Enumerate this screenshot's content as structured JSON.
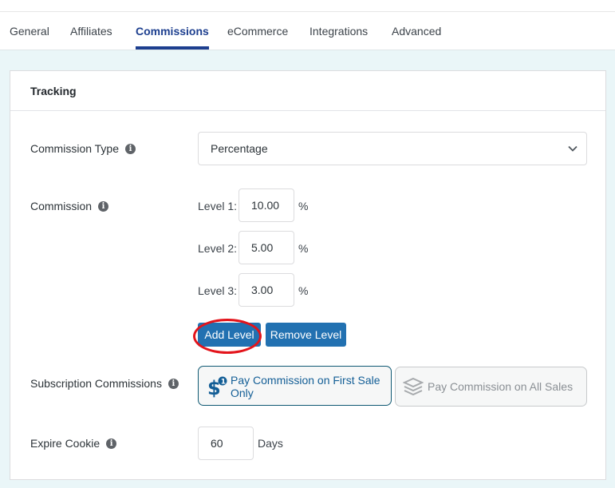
{
  "tabs": [
    {
      "label": "General",
      "active": false
    },
    {
      "label": "Affiliates",
      "active": false
    },
    {
      "label": "Commissions",
      "active": true
    },
    {
      "label": "eCommerce",
      "active": false
    },
    {
      "label": "Integrations",
      "active": false
    },
    {
      "label": "Advanced",
      "active": false
    }
  ],
  "colors": {
    "accent": "#1d3f8f",
    "button": "#2271b1",
    "highlight": "#e3141b",
    "background": "#eaf6f8"
  },
  "card": {
    "title": "Tracking",
    "commission_type": {
      "label": "Commission Type",
      "icon": "info-icon",
      "selected": "Percentage"
    },
    "commission": {
      "label": "Commission",
      "icon": "info-icon",
      "levels": [
        {
          "label": "Level 1:",
          "value": "10.00",
          "unit": "%"
        },
        {
          "label": "Level 2:",
          "value": "5.00",
          "unit": "%"
        },
        {
          "label": "Level 3:",
          "value": "3.00",
          "unit": "%"
        }
      ],
      "add_level": "Add Level",
      "remove_level": "Remove Level"
    },
    "subscription": {
      "label": "Subscription Commissions",
      "icon": "info-icon",
      "options": [
        {
          "label": "Pay Commission on First Sale Only",
          "icon": "dollar-one-icon",
          "selected": true
        },
        {
          "label": "Pay Commission on All Sales",
          "icon": "stacked-coins-icon",
          "selected": false
        }
      ]
    },
    "expire_cookie": {
      "label": "Expire Cookie",
      "icon": "info-icon",
      "value": "60",
      "unit": "Days"
    }
  }
}
